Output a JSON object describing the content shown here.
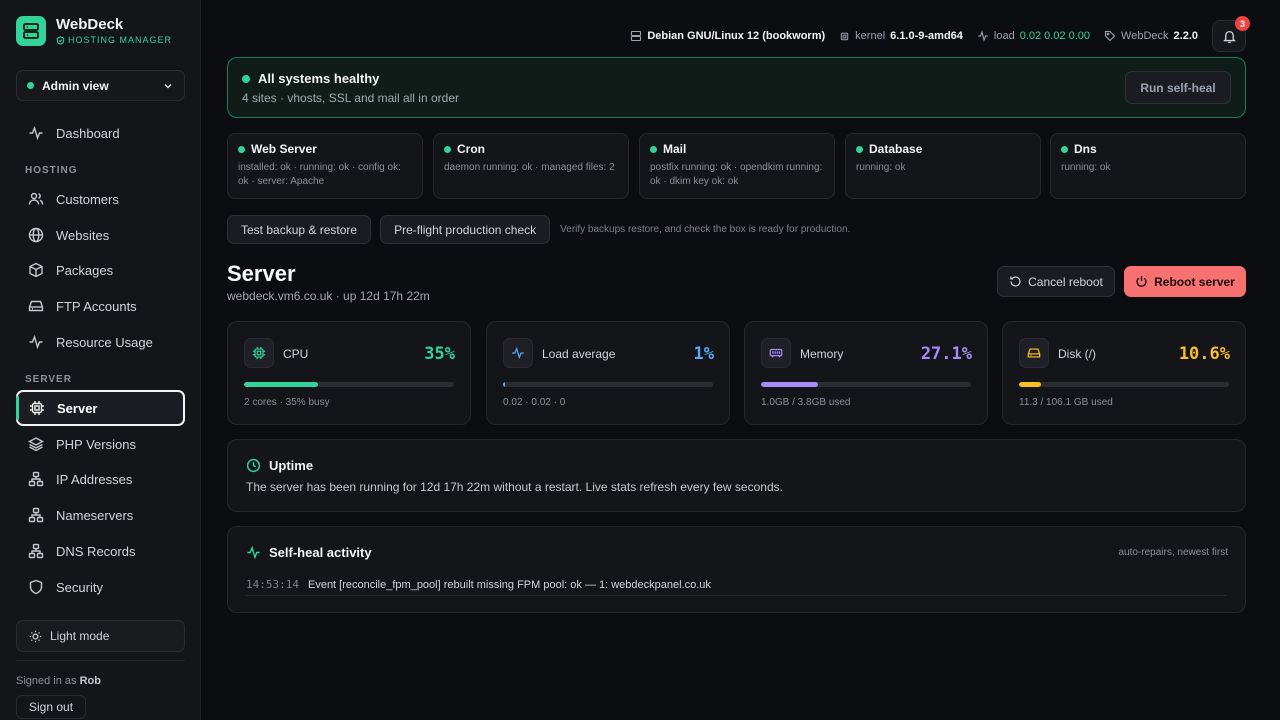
{
  "brand": {
    "name": "WebDeck",
    "subtitle": "HOSTING MANAGER"
  },
  "view_selector": {
    "label": "Admin view"
  },
  "nav": {
    "dashboard": "Dashboard",
    "hosting_section": "HOSTING",
    "hosting_items": [
      "Customers",
      "Websites",
      "Packages",
      "FTP Accounts",
      "Resource Usage"
    ],
    "server_section": "SERVER",
    "server_items": [
      "Server",
      "PHP Versions",
      "IP Addresses",
      "Nameservers",
      "DNS Records",
      "Security"
    ],
    "active": "Server"
  },
  "sidebar_footer": {
    "light_mode": "Light mode",
    "signed_in_prefix": "Signed in as",
    "user": "Rob",
    "sign_out": "Sign out"
  },
  "topbar": {
    "os": "Debian GNU/Linux 12 (bookworm)",
    "kernel_label": "kernel",
    "kernel": "6.1.0-9-amd64",
    "load_label": "load",
    "load": "0.02 0.02 0.00",
    "app_label": "WebDeck",
    "app_version": "2.2.0",
    "notifications": "3"
  },
  "health": {
    "title": "All systems healthy",
    "subtitle": "4 sites · vhosts, SSL and mail all in order",
    "button": "Run self-heal"
  },
  "services": [
    {
      "name": "Web Server",
      "desc": "installed: ok · running: ok · config ok: ok · server: Apache"
    },
    {
      "name": "Cron",
      "desc": "daemon running: ok · managed files: 2"
    },
    {
      "name": "Mail",
      "desc": "postfix running: ok · opendkim running: ok · dkim key ok: ok"
    },
    {
      "name": "Database",
      "desc": "running: ok"
    },
    {
      "name": "Dns",
      "desc": "running: ok"
    }
  ],
  "actions": {
    "backup": "Test backup & restore",
    "preflight": "Pre-flight production check",
    "hint": "Verify backups restore, and check the box is ready for production."
  },
  "server": {
    "title": "Server",
    "subtitle": "webdeck.vm6.co.uk · up 12d 17h 22m",
    "cancel_reboot": "Cancel reboot",
    "reboot": "Reboot server"
  },
  "stats": [
    {
      "label": "CPU",
      "value": "35%",
      "percent": 35,
      "foot": "2 cores · 35% busy",
      "color": "#34d399",
      "icon": "cpu-icon"
    },
    {
      "label": "Load average",
      "value": "1%",
      "percent": 1,
      "foot": "0.02 · 0.02 · 0",
      "color": "#60a5fa",
      "icon": "activity-icon"
    },
    {
      "label": "Memory",
      "value": "27.1%",
      "percent": 27.1,
      "foot": "1.0GB / 3.8GB used",
      "color": "#a78bfa",
      "icon": "memory-icon"
    },
    {
      "label": "Disk (/)",
      "value": "10.6%",
      "percent": 10.6,
      "foot": "11.3 / 106.1 GB used",
      "color": "#fbbf24",
      "icon": "disk-icon"
    }
  ],
  "uptime": {
    "title": "Uptime",
    "text": "The server has been running for 12d 17h 22m without a restart. Live stats refresh every few seconds."
  },
  "activity": {
    "title": "Self-heal activity",
    "subtitle": "auto-repairs, newest first",
    "entries": [
      {
        "time": "14:53:14",
        "text": "Event [reconcile_fpm_pool] rebuilt missing FPM pool: ok — 1: webdeckpanel.co.uk"
      }
    ]
  }
}
